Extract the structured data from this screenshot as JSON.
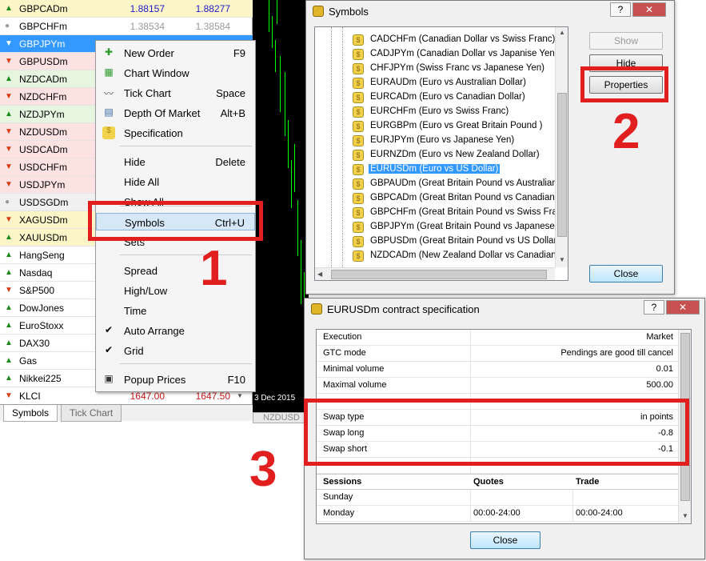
{
  "market_watch": {
    "rows": [
      {
        "dir": "up",
        "symbol": "GBPCADm",
        "bid": "1.88157",
        "ask": "1.88277",
        "bg": "yellow",
        "price_color": "blue"
      },
      {
        "dir": "flat",
        "symbol": "GBPCHFm",
        "bid": "1.38534",
        "ask": "1.38584",
        "bg": "white",
        "price_color": "faded"
      },
      {
        "dir": "down",
        "symbol": "GBPJPYm",
        "bid": "",
        "ask": "",
        "bg": "selected",
        "price_color": "blue"
      },
      {
        "dir": "down",
        "symbol": "GBPUSDm",
        "bid": "",
        "ask": "",
        "bg": "pink",
        "price_color": "blue"
      },
      {
        "dir": "up",
        "symbol": "NZDCADm",
        "bid": "",
        "ask": "",
        "bg": "green",
        "price_color": "blue"
      },
      {
        "dir": "down",
        "symbol": "NZDCHFm",
        "bid": "",
        "ask": "",
        "bg": "pink",
        "price_color": "blue"
      },
      {
        "dir": "up",
        "symbol": "NZDJPYm",
        "bid": "",
        "ask": "",
        "bg": "green",
        "price_color": "blue"
      },
      {
        "dir": "down",
        "symbol": "NZDUSDm",
        "bid": "",
        "ask": "",
        "bg": "pink",
        "price_color": "blue"
      },
      {
        "dir": "down",
        "symbol": "USDCADm",
        "bid": "",
        "ask": "",
        "bg": "pink",
        "price_color": "blue"
      },
      {
        "dir": "down",
        "symbol": "USDCHFm",
        "bid": "",
        "ask": "",
        "bg": "pink",
        "price_color": "blue"
      },
      {
        "dir": "down",
        "symbol": "USDJPYm",
        "bid": "",
        "ask": "",
        "bg": "pink",
        "price_color": "blue"
      },
      {
        "dir": "flat",
        "symbol": "USDSGDm",
        "bid": "",
        "ask": "",
        "bg": "grey",
        "price_color": "blue"
      },
      {
        "dir": "down",
        "symbol": "XAGUSDm",
        "bid": "",
        "ask": "",
        "bg": "yellow",
        "price_color": "blue"
      },
      {
        "dir": "up",
        "symbol": "XAUUSDm",
        "bid": "",
        "ask": "",
        "bg": "yellow",
        "price_color": "blue"
      },
      {
        "dir": "up",
        "symbol": "HangSeng",
        "bid": "",
        "ask": "",
        "bg": "white",
        "price_color": "blue"
      },
      {
        "dir": "up",
        "symbol": "Nasdaq",
        "bid": "",
        "ask": "",
        "bg": "white",
        "price_color": "blue"
      },
      {
        "dir": "down",
        "symbol": "S&P500",
        "bid": "",
        "ask": "",
        "bg": "white",
        "price_color": "blue"
      },
      {
        "dir": "up",
        "symbol": "DowJones",
        "bid": "",
        "ask": "",
        "bg": "white",
        "price_color": "blue"
      },
      {
        "dir": "up",
        "symbol": "EuroStoxx",
        "bid": "",
        "ask": "",
        "bg": "white",
        "price_color": "blue"
      },
      {
        "dir": "up",
        "symbol": "DAX30",
        "bid": "",
        "ask": "",
        "bg": "white",
        "price_color": "blue"
      },
      {
        "dir": "up",
        "symbol": "Gas",
        "bid": "",
        "ask": "",
        "bg": "white",
        "price_color": "blue"
      },
      {
        "dir": "up",
        "symbol": "Nikkei225",
        "bid": "",
        "ask": "",
        "bg": "white",
        "price_color": "blue"
      },
      {
        "dir": "down",
        "symbol": "KLCI",
        "bid": "1647.00",
        "ask": "1647.50",
        "bg": "white",
        "price_color": "red"
      }
    ],
    "tabs": [
      "Symbols",
      "Tick Chart"
    ]
  },
  "chart": {
    "date_label": "3 Dec 2015",
    "tab_label": "NZDUSD"
  },
  "context_menu": {
    "items": [
      {
        "label": "New Order",
        "shortcut": "F9",
        "icon": "new-order-icon"
      },
      {
        "label": "Chart Window",
        "shortcut": "",
        "icon": "chart-window-icon"
      },
      {
        "label": "Tick Chart",
        "shortcut": "Space",
        "icon": "tick-chart-icon"
      },
      {
        "label": "Depth Of Market",
        "shortcut": "Alt+B",
        "icon": "depth-of-market-icon"
      },
      {
        "label": "Specification",
        "shortcut": "",
        "icon": "specification-icon"
      },
      {
        "label": "Hide",
        "shortcut": "Delete",
        "icon": ""
      },
      {
        "label": "Hide All",
        "shortcut": "",
        "icon": ""
      },
      {
        "label": "Show All",
        "shortcut": "",
        "icon": ""
      },
      {
        "label": "Symbols",
        "shortcut": "Ctrl+U",
        "icon": ""
      },
      {
        "label": "Sets",
        "shortcut": "",
        "icon": ""
      },
      {
        "label": "Spread",
        "shortcut": "",
        "icon": ""
      },
      {
        "label": "High/Low",
        "shortcut": "",
        "icon": ""
      },
      {
        "label": "Time",
        "shortcut": "",
        "icon": ""
      },
      {
        "label": "Auto Arrange",
        "shortcut": "",
        "icon": "check-icon"
      },
      {
        "label": "Grid",
        "shortcut": "",
        "icon": "check-icon"
      },
      {
        "label": "Popup Prices",
        "shortcut": "F10",
        "icon": "popup-prices-icon"
      }
    ]
  },
  "symbols_window": {
    "title": "Symbols",
    "help_btn": "?",
    "close_btn": "✕",
    "tree_items": [
      {
        "sym": "CADCHFm",
        "desc": "(Canadian Dollar vs Swiss Franc)"
      },
      {
        "sym": "CADJPYm",
        "desc": "(Canadian Dollar vs Japanise Yen)"
      },
      {
        "sym": "CHFJPYm",
        "desc": "(Swiss Franc vs Japanese Yen)"
      },
      {
        "sym": "EURAUDm",
        "desc": "(Euro vs Australian Dollar)"
      },
      {
        "sym": "EURCADm",
        "desc": "(Euro vs Canadian Dollar)"
      },
      {
        "sym": "EURCHFm",
        "desc": "(Euro vs Swiss Franc)"
      },
      {
        "sym": "EURGBPm",
        "desc": "(Euro vs Great Britain Pound )"
      },
      {
        "sym": "EURJPYm",
        "desc": "(Euro vs Japanese Yen)"
      },
      {
        "sym": "EURNZDm",
        "desc": "(Euro vs New Zealand Dollar)"
      },
      {
        "sym": "EURUSDm",
        "desc": "(Euro vs US Dollar)"
      },
      {
        "sym": "GBPAUDm",
        "desc": "(Great Britain Pound vs Australian Dollar)"
      },
      {
        "sym": "GBPCADm",
        "desc": "(Great Britan Pound vs Canadian Dollar)"
      },
      {
        "sym": "GBPCHFm",
        "desc": "(Great Britain Pound vs Swiss Franc)"
      },
      {
        "sym": "GBPJPYm",
        "desc": "(Great Britain Pound vs Japanese Yen)"
      },
      {
        "sym": "GBPUSDm",
        "desc": "(Great Britain Pound vs US Dollar)"
      },
      {
        "sym": "NZDCADm",
        "desc": "(New Zealand Dollar vs Canadian Dollar)"
      }
    ],
    "selected_index": 9,
    "buttons": {
      "show": "Show",
      "hide": "Hide",
      "properties": "Properties",
      "close": "Close"
    }
  },
  "spec_window": {
    "title": "EURUSDm contract specification",
    "help_btn": "?",
    "close_btn": "✕",
    "rows": [
      {
        "k": "Execution",
        "v": "Market"
      },
      {
        "k": "GTC mode",
        "v": "Pendings are good till cancel"
      },
      {
        "k": "Minimal volume",
        "v": "0.01"
      },
      {
        "k": "Maximal volume",
        "v": "500.00"
      },
      {
        "k": "",
        "v": ""
      },
      {
        "k": "Swap type",
        "v": "in points"
      },
      {
        "k": "Swap long",
        "v": "-0.8"
      },
      {
        "k": "Swap short",
        "v": "-0.1"
      },
      {
        "k": "",
        "v": ""
      }
    ],
    "sessions_header": {
      "c1": "Sessions",
      "c2": "Quotes",
      "c3": "Trade"
    },
    "sessions": [
      {
        "day": "Sunday",
        "q": "",
        "t": ""
      },
      {
        "day": "Monday",
        "q": "00:00-24:00",
        "t": "00:00-24:00"
      }
    ],
    "close_label": "Close"
  },
  "annotations": {
    "one": "1",
    "two": "2",
    "three": "3"
  },
  "colors": {
    "annotation_red": "#e11f1f",
    "selection_blue": "#3399ff"
  }
}
